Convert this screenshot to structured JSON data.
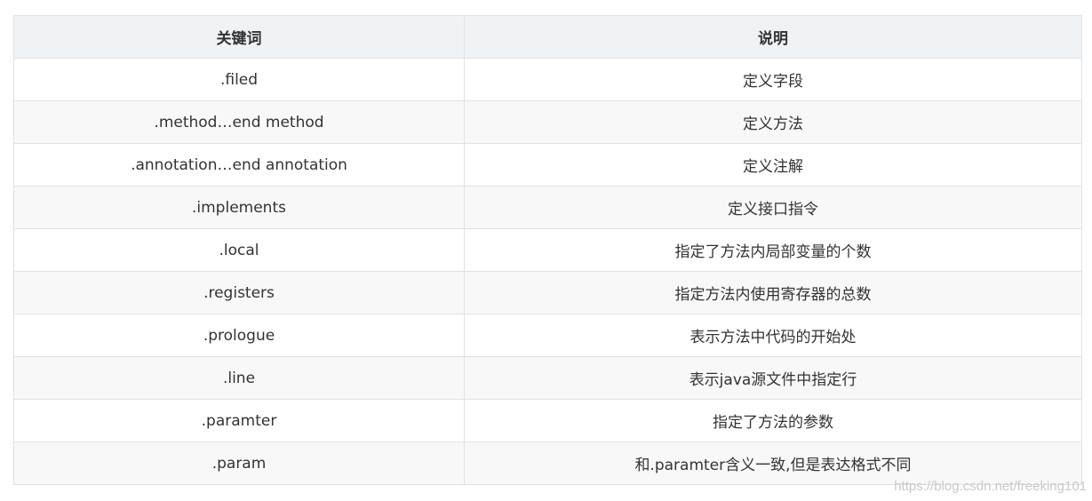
{
  "table": {
    "headers": [
      "关键词",
      "说明"
    ],
    "rows": [
      [
        ".filed",
        "定义字段"
      ],
      [
        ".method…end method",
        "定义方法"
      ],
      [
        ".annotation…end annotation",
        "定义注解"
      ],
      [
        ".implements",
        "定义接口指令"
      ],
      [
        ".local",
        "指定了方法内局部变量的个数"
      ],
      [
        ".registers",
        "指定方法内使用寄存器的总数"
      ],
      [
        ".prologue",
        "表示方法中代码的开始处"
      ],
      [
        ".line",
        "表示java源文件中指定行"
      ],
      [
        ".paramter",
        "指定了方法的参数"
      ],
      [
        ".param",
        "和.paramter含义一致,但是表达格式不同"
      ]
    ]
  },
  "watermark": "https://blog.csdn.net/freeking101"
}
